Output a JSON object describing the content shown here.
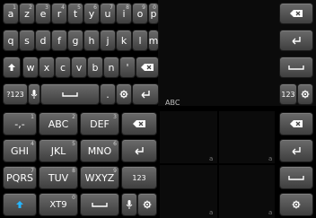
{
  "qwerty_top": {
    "row1": [
      "a",
      "z",
      "e",
      "r",
      "t",
      "y",
      "u",
      "i",
      "o",
      "p"
    ],
    "row1_hints": [
      "1",
      "2",
      "3",
      "4",
      "5",
      "6",
      "7",
      "8",
      "9",
      "0"
    ],
    "row2": [
      "q",
      "s",
      "d",
      "f",
      "g",
      "h",
      "j",
      "k",
      "l",
      "m"
    ],
    "row3": [
      "w",
      "x",
      "c",
      "v",
      "b",
      "n",
      "'"
    ],
    "row4": {
      "mode_label": "?123",
      "dot": "."
    }
  },
  "midline": {
    "abc_label": "ABC"
  },
  "t9": {
    "row1": [
      "-,-",
      "ABC",
      "DEF"
    ],
    "row1_hints": [
      "1",
      "2",
      "3"
    ],
    "row2": [
      "GHI",
      "JKL",
      "MNO"
    ],
    "row2_hints": [
      "4",
      "5",
      "6"
    ],
    "row3": [
      "PQRS",
      "TUV",
      "WXYZ"
    ],
    "row3_hints": [
      "7",
      "8",
      "9"
    ],
    "row3_extra": "123",
    "row4": {
      "mode_label": "XT9",
      "hint": "0"
    }
  },
  "right_column": {
    "mode_label": "123"
  },
  "corner_letters": [
    "a",
    "a",
    "a",
    "a"
  ],
  "icons": [
    "delete-icon",
    "enter-icon",
    "space-icon",
    "shift-icon",
    "mic-icon",
    "gear-icon"
  ],
  "colors": {
    "background": "#000000",
    "key_top": "#6a6a6a",
    "key_bottom": "#3f3f3f",
    "accent_blue": "#25b5ff"
  }
}
